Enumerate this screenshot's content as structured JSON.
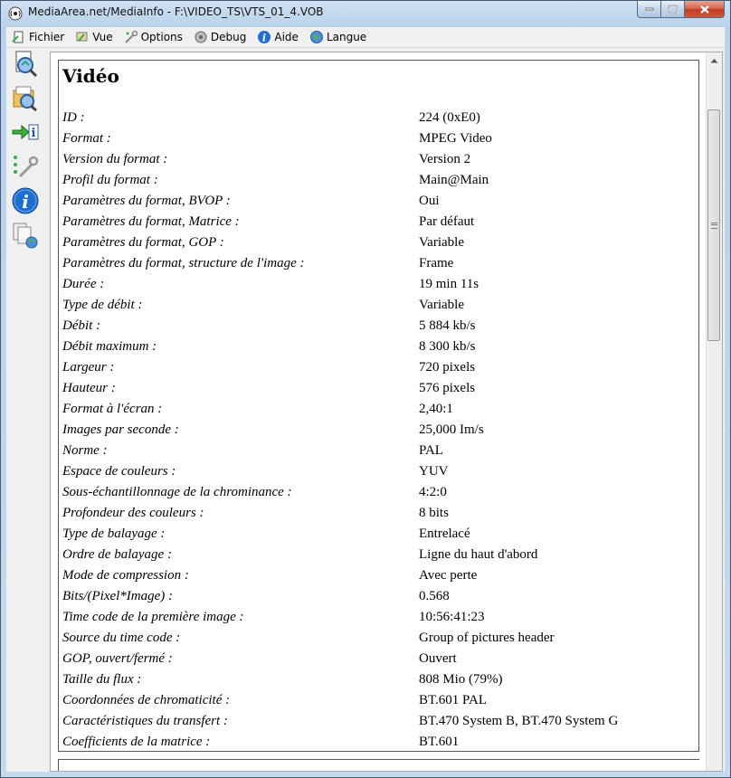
{
  "window": {
    "title": "MediaArea.net/MediaInfo - F:\\VIDEO_TS\\VTS_01_4.VOB"
  },
  "menu": {
    "items": [
      {
        "label": "Fichier",
        "icon": "file-icon"
      },
      {
        "label": "Vue",
        "icon": "view-icon"
      },
      {
        "label": "Options",
        "icon": "options-icon"
      },
      {
        "label": "Debug",
        "icon": "debug-icon"
      },
      {
        "label": "Aide",
        "icon": "help-icon"
      },
      {
        "label": "Langue",
        "icon": "language-icon"
      }
    ]
  },
  "sidebar": {
    "buttons": [
      "open-file-icon",
      "open-folder-icon",
      "export-icon",
      "preferences-icon",
      "about-icon",
      "knowledge-icon"
    ]
  },
  "section": {
    "title": "Vidéo",
    "rows": [
      {
        "label": "ID :",
        "value": "224 (0xE0)"
      },
      {
        "label": "Format :",
        "value": "MPEG Video"
      },
      {
        "label": "Version du format :",
        "value": "Version 2"
      },
      {
        "label": "Profil du format :",
        "value": "Main@Main"
      },
      {
        "label": "Paramètres du format, BVOP :",
        "value": "Oui"
      },
      {
        "label": "Paramètres du format, Matrice :",
        "value": "Par défaut"
      },
      {
        "label": "Paramètres du format, GOP :",
        "value": "Variable"
      },
      {
        "label": "Paramètres du format, structure de l'image :",
        "value": "Frame"
      },
      {
        "label": "Durée :",
        "value": "19 min 11s"
      },
      {
        "label": "Type de débit :",
        "value": "Variable"
      },
      {
        "label": "Débit :",
        "value": "5 884 kb/s"
      },
      {
        "label": "Débit maximum :",
        "value": "8 300 kb/s"
      },
      {
        "label": "Largeur :",
        "value": "720 pixels"
      },
      {
        "label": "Hauteur :",
        "value": "576 pixels"
      },
      {
        "label": "Format à l'écran :",
        "value": "2,40:1"
      },
      {
        "label": "Images par seconde :",
        "value": "25,000 Im/s"
      },
      {
        "label": "Norme :",
        "value": "PAL"
      },
      {
        "label": "Espace de couleurs :",
        "value": "YUV"
      },
      {
        "label": "Sous-échantillonnage de la chrominance :",
        "value": "4:2:0"
      },
      {
        "label": "Profondeur des couleurs :",
        "value": "8 bits"
      },
      {
        "label": "Type de balayage :",
        "value": "Entrelacé"
      },
      {
        "label": "Ordre de balayage :",
        "value": "Ligne du haut d'abord"
      },
      {
        "label": "Mode de compression :",
        "value": "Avec perte"
      },
      {
        "label": "Bits/(Pixel*Image) :",
        "value": "0.568"
      },
      {
        "label": "Time code de la première image :",
        "value": "10:56:41:23"
      },
      {
        "label": "Source du time code :",
        "value": "Group of pictures header"
      },
      {
        "label": "GOP, ouvert/fermé :",
        "value": "Ouvert"
      },
      {
        "label": "Taille du flux :",
        "value": "808 Mio (79%)"
      },
      {
        "label": "Coordonnées de chromaticité :",
        "value": "BT.601 PAL"
      },
      {
        "label": "Caractéristiques du transfert :",
        "value": "BT.470 System B, BT.470 System G"
      },
      {
        "label": "Coefficients de la matrice :",
        "value": "BT.601"
      }
    ]
  }
}
